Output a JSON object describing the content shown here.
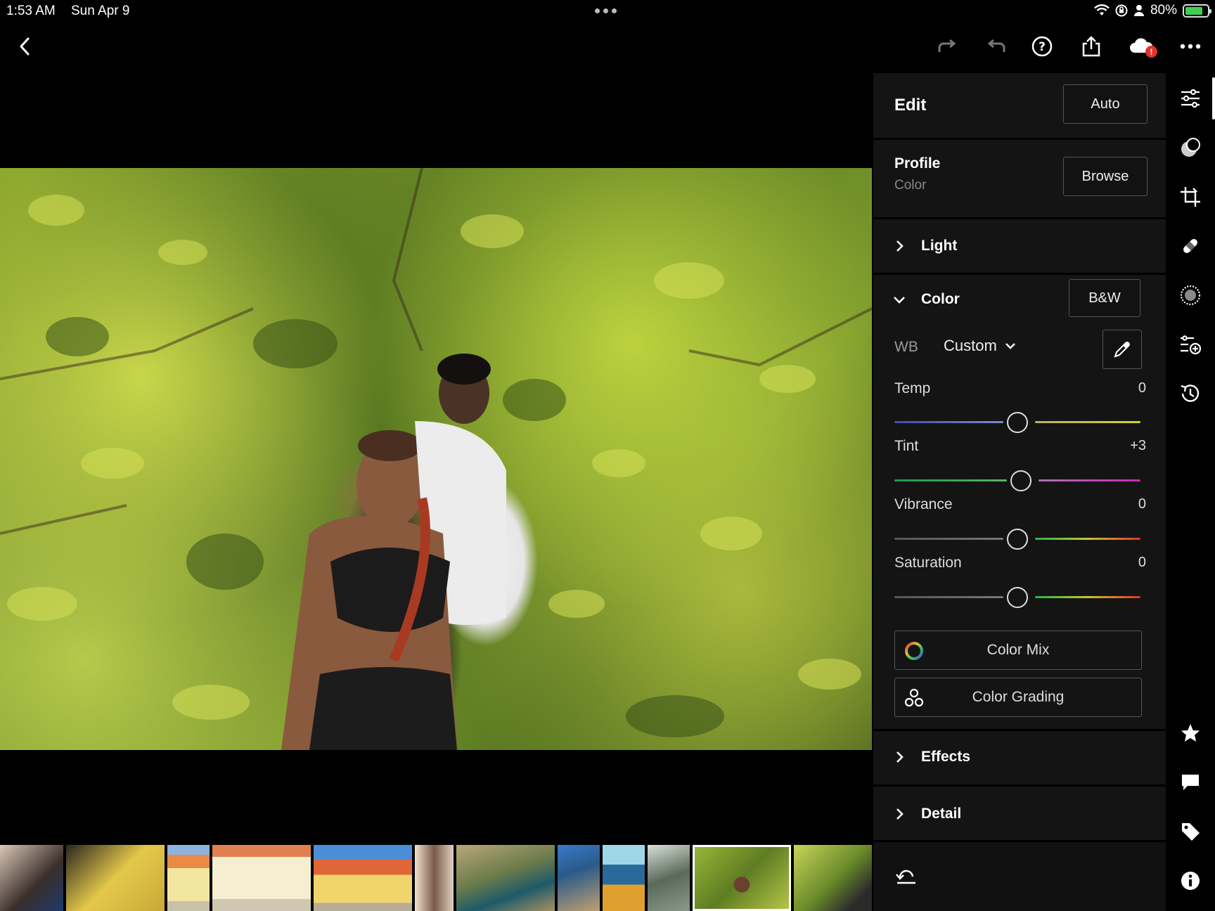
{
  "status_bar": {
    "time": "1:53 AM",
    "date": "Sun Apr 9",
    "battery_percent": "80%",
    "battery_level": 0.8
  },
  "toolbar": {
    "icons": [
      "back-icon",
      "redo-icon",
      "undo-icon",
      "help-icon",
      "share-icon",
      "cloud-sync-icon",
      "more-icon"
    ],
    "cloud_badge": "!"
  },
  "edit_panel": {
    "title": "Edit",
    "auto_label": "Auto",
    "profile": {
      "label": "Profile",
      "value": "Color",
      "browse_label": "Browse"
    },
    "sections": {
      "light": "Light",
      "color": "Color",
      "effects": "Effects",
      "detail": "Detail"
    },
    "color": {
      "bw_label": "B&W",
      "wb_label": "WB",
      "wb_value": "Custom",
      "sliders": [
        {
          "name": "Temp",
          "value": "0",
          "position": 0.5
        },
        {
          "name": "Tint",
          "value": "+3",
          "position": 0.515
        },
        {
          "name": "Vibrance",
          "value": "0",
          "position": 0.5
        },
        {
          "name": "Saturation",
          "value": "0",
          "position": 0.5
        }
      ],
      "color_mix_label": "Color Mix",
      "color_grading_label": "Color Grading"
    }
  },
  "right_rail": {
    "icons": [
      "edit-sliders-icon",
      "masking-icon",
      "crop-icon",
      "healing-icon",
      "optics-icon",
      "presets-icon",
      "versions-icon",
      "star-icon",
      "comment-icon",
      "tag-icon",
      "info-icon"
    ]
  },
  "filmstrip": {
    "thumbnails": 13,
    "selected_index": 11
  },
  "colors": {
    "panel_bg": "#141414",
    "accent_white": "#ffffff",
    "badge_red": "#e0332d",
    "battery_green": "#3ed14d"
  }
}
